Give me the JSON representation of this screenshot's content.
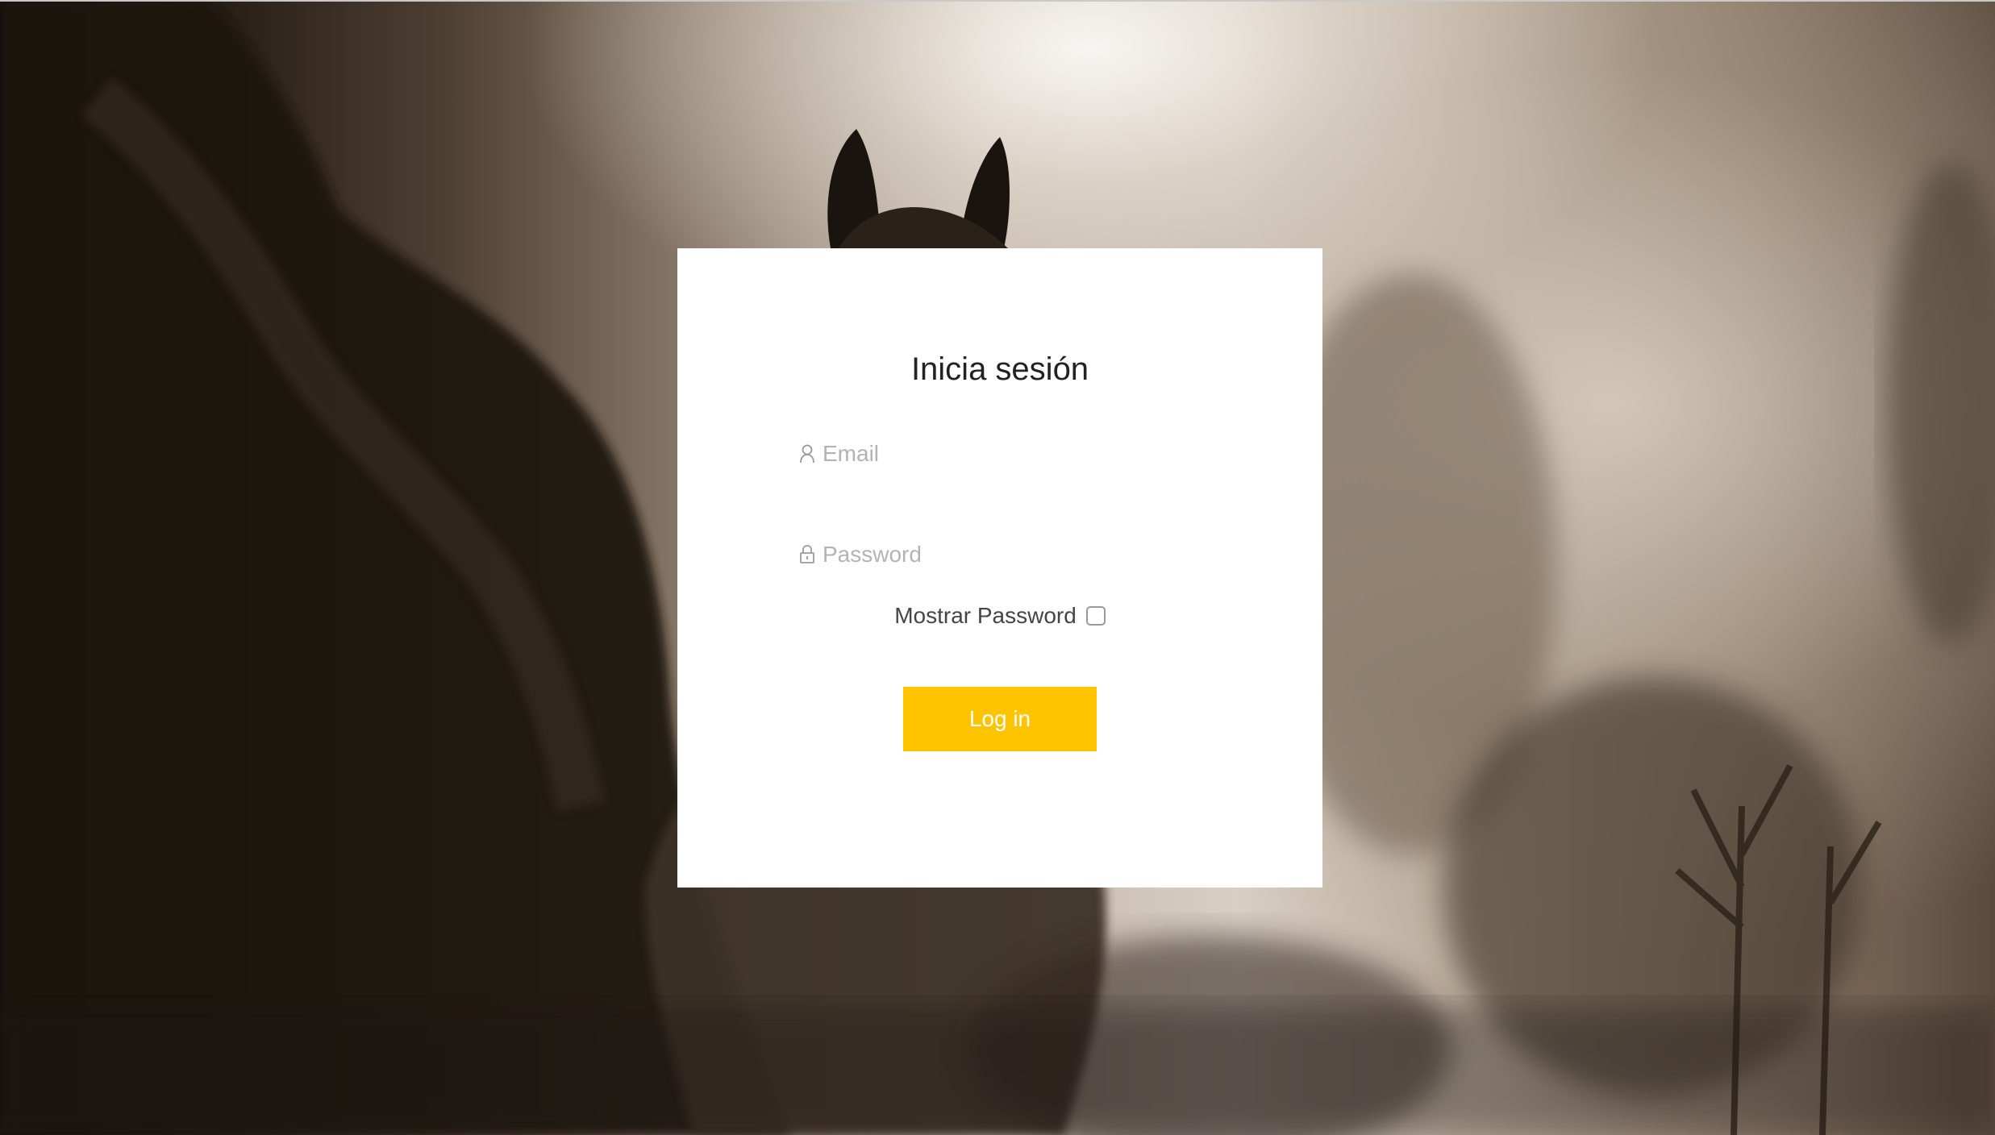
{
  "login": {
    "title": "Inicia sesión",
    "email_placeholder": "Email",
    "password_placeholder": "Password",
    "show_password_label": "Mostrar Password",
    "show_password_checked": false,
    "login_button": "Log in"
  },
  "icons": {
    "email": "user-icon",
    "password": "lock-icon"
  },
  "colors": {
    "accent": "#ffc400",
    "card_background": "#ffffff",
    "title_text": "#222222",
    "placeholder_text": "#b3b3b3"
  }
}
